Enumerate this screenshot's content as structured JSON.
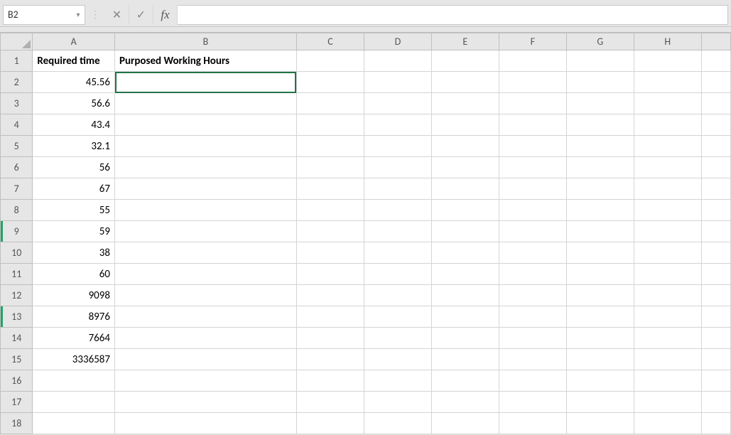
{
  "namebox": {
    "value": "B2"
  },
  "formula_bar": {
    "value": ""
  },
  "icons": {
    "dropdown": "▾",
    "splitter": "⋮",
    "cancel": "✕",
    "enter": "✓",
    "fx": "fx"
  },
  "columns": [
    "A",
    "B",
    "C",
    "D",
    "E",
    "F",
    "G",
    "H",
    ""
  ],
  "row_numbers": [
    "1",
    "2",
    "3",
    "4",
    "5",
    "6",
    "7",
    "8",
    "9",
    "10",
    "11",
    "12",
    "13",
    "14",
    "15",
    "16",
    "17",
    "18"
  ],
  "headers": {
    "A1": "Required time",
    "B1": "Purposed Working Hours"
  },
  "colA": {
    "r2": "45.56",
    "r3": "56.6",
    "r4": "43.4",
    "r5": "32.1",
    "r6": "56",
    "r7": "67",
    "r8": "55",
    "r9": "59",
    "r10": "38",
    "r11": "60",
    "r12": "9098",
    "r13": "8976",
    "r14": "7664",
    "r15": "3336587"
  },
  "active_cell": "B2",
  "marked_rows": [
    9,
    13
  ],
  "chart_data": {
    "type": "table",
    "columns": [
      "Required time",
      "Purposed Working Hours"
    ],
    "rows": [
      [
        45.56,
        null
      ],
      [
        56.6,
        null
      ],
      [
        43.4,
        null
      ],
      [
        32.1,
        null
      ],
      [
        56,
        null
      ],
      [
        67,
        null
      ],
      [
        55,
        null
      ],
      [
        59,
        null
      ],
      [
        38,
        null
      ],
      [
        60,
        null
      ],
      [
        9098,
        null
      ],
      [
        8976,
        null
      ],
      [
        7664,
        null
      ],
      [
        3336587,
        null
      ]
    ]
  }
}
